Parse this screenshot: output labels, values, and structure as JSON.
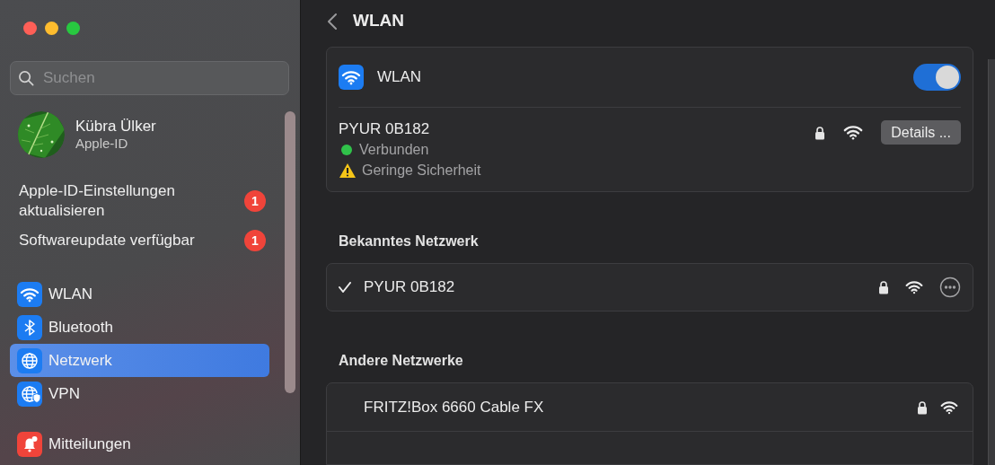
{
  "sidebar": {
    "search": {
      "placeholder": "Suchen"
    },
    "account": {
      "name": "Kübra Ülker",
      "subtitle": "Apple-ID"
    },
    "notices": [
      {
        "label": "Apple-ID-Einstellungen aktualisieren",
        "badge": "1"
      },
      {
        "label": "Softwareupdate verfügbar",
        "badge": "1"
      }
    ],
    "groups": [
      {
        "items": [
          {
            "label": "WLAN",
            "kind": "wifi",
            "selected": false
          },
          {
            "label": "Bluetooth",
            "kind": "bluetooth",
            "selected": false
          },
          {
            "label": "Netzwerk",
            "kind": "network",
            "selected": true
          },
          {
            "label": "VPN",
            "kind": "vpn",
            "selected": false
          }
        ]
      },
      {
        "items": [
          {
            "label": "Mitteilungen",
            "kind": "notifications",
            "selected": false
          }
        ]
      }
    ]
  },
  "header": {
    "title": "WLAN"
  },
  "wifi_card": {
    "label": "WLAN",
    "on": true,
    "current": {
      "name": "PYUR 0B182",
      "status": "Verbunden",
      "warning": "Geringe Sicherheit",
      "locked": true,
      "button": "Details ..."
    }
  },
  "known": {
    "heading": "Bekanntes Netzwerk",
    "networks": [
      {
        "name": "PYUR 0B182",
        "checked": true,
        "locked": true
      }
    ]
  },
  "others": {
    "heading": "Andere Netzwerke",
    "networks": [
      {
        "name": "FRITZ!Box 6660 Cable FX",
        "locked": true
      }
    ]
  }
}
